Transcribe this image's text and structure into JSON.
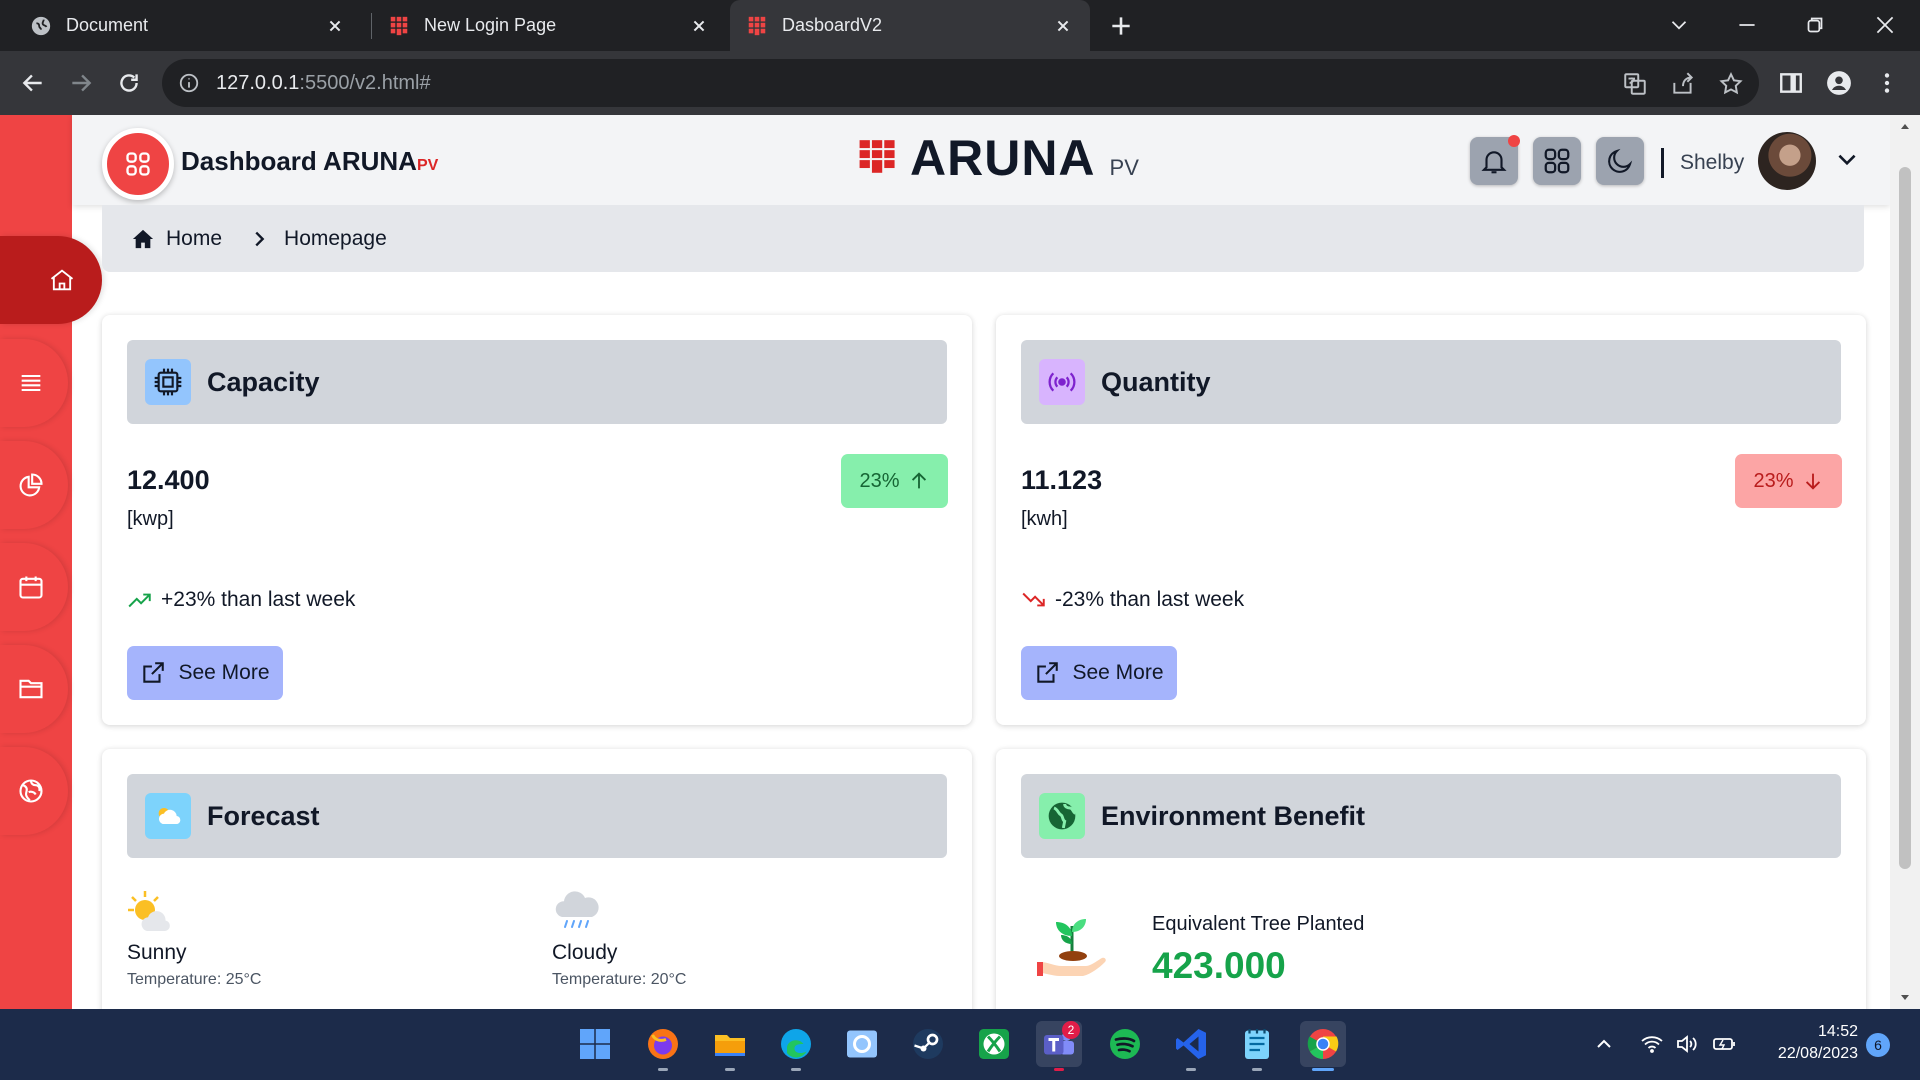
{
  "browser": {
    "tabs": [
      {
        "title": "Document",
        "icon": "globe-icon",
        "active": false
      },
      {
        "title": "New Login Page",
        "icon": "aruna-grid-icon",
        "active": false
      },
      {
        "title": "DasboardV2",
        "icon": "aruna-grid-icon",
        "active": true
      }
    ],
    "url_host": "127.0.0.1",
    "url_rest": ":5500/v2.html#"
  },
  "header": {
    "title": "Dashboard ARUNA",
    "title_suffix": "PV",
    "brand_name": "ARUNA",
    "brand_suffix": "PV",
    "user_name": "Shelby"
  },
  "breadcrumb": {
    "home": "Home",
    "current": "Homepage"
  },
  "cards": {
    "capacity": {
      "title": "Capacity",
      "value": "12.400",
      "unit": "[kwp]",
      "badge": "23%",
      "trend": "+23% than last week",
      "button": "See More"
    },
    "quantity": {
      "title": "Quantity",
      "value": "11.123",
      "unit": "[kwh]",
      "badge": "23%",
      "trend": "-23% than last week",
      "button": "See More"
    },
    "forecast": {
      "title": "Forecast",
      "items": [
        {
          "label": "Sunny",
          "temp": "Temperature: 25°C",
          "icon": "sunny-icon"
        },
        {
          "label": "Cloudy",
          "temp": "Temperature: 20°C",
          "icon": "rain-cloud-icon"
        }
      ]
    },
    "environment": {
      "title": "Environment Benefit",
      "label": "Equivalent Tree Planted",
      "value": "423.000"
    }
  },
  "taskbar": {
    "time": "14:52",
    "date": "22/08/2023",
    "notifications": "6",
    "teams_badge": "2"
  },
  "colors": {
    "sidebar": "#ef4444",
    "sidebar_active": "#b91c1c",
    "badge_up": "#86efac",
    "badge_down": "#fca5a5",
    "button": "#a5b4fc",
    "env_value": "#16a34a"
  }
}
